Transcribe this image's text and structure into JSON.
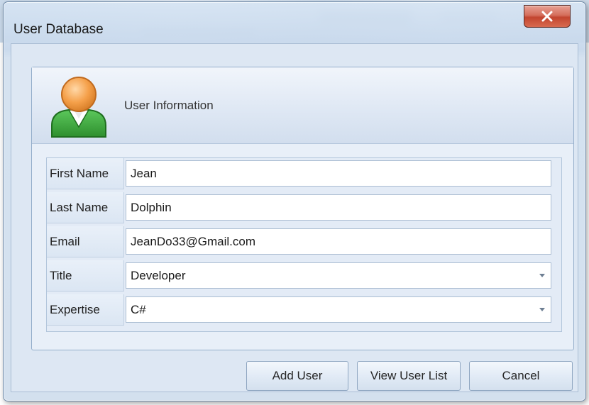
{
  "window": {
    "title": "User Database"
  },
  "header": {
    "label": "User Information"
  },
  "form": {
    "rows": [
      {
        "label": "First Name",
        "value": "Jean",
        "type": "text"
      },
      {
        "label": "Last Name",
        "value": "Dolphin",
        "type": "text"
      },
      {
        "label": "Email",
        "value": "JeanDo33@Gmail.com",
        "type": "text"
      },
      {
        "label": "Title",
        "value": "Developer",
        "type": "combo"
      },
      {
        "label": "Expertise",
        "value": "C#",
        "type": "combo"
      }
    ]
  },
  "buttons": {
    "add": "Add User",
    "view": "View User List",
    "cancel": "Cancel"
  },
  "icons": {
    "close": "close-icon",
    "avatar": "user-avatar-icon",
    "dropdown": "chevron-down-icon"
  },
  "colors": {
    "close_button": "#c8452f",
    "avatar_body": "#3aa83a",
    "avatar_head": "#f5a04a"
  }
}
